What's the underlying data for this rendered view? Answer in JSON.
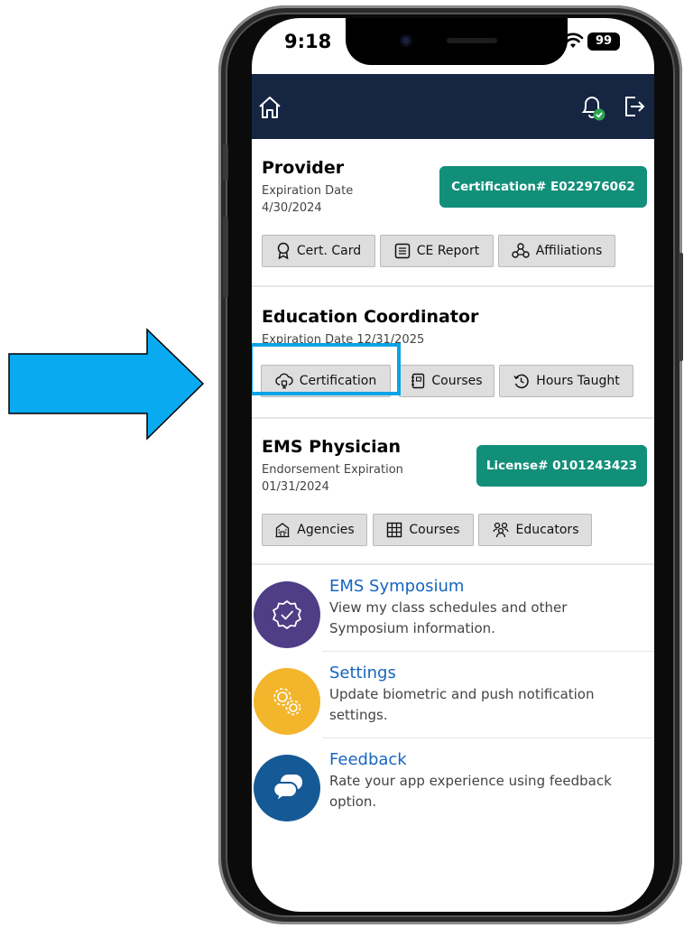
{
  "status_bar": {
    "time": "9:18",
    "battery": "99"
  },
  "provider": {
    "title": "Provider",
    "expiration_label": "Expiration Date",
    "expiration_date": "4/30/2024",
    "certification": "Certification# E022976062",
    "buttons": {
      "cert_card": "Cert. Card",
      "ce_report": "CE Report",
      "affiliations": "Affiliations"
    }
  },
  "education": {
    "title": "Education Coordinator",
    "expiration": "Expiration Date 12/31/2025",
    "buttons": {
      "certification": "Certification",
      "courses": "Courses",
      "hours_taught": "Hours Taught"
    }
  },
  "physician": {
    "title": "EMS Physician",
    "expiration_label": "Endorsement Expiration",
    "expiration_date": "01/31/2024",
    "license": "License# 0101243423",
    "buttons": {
      "agencies": "Agencies",
      "courses": "Courses",
      "educators": "Educators"
    }
  },
  "menu": [
    {
      "title": "EMS Symposium",
      "desc": "View my class schedules and other Symposium information.",
      "icon": "badge-check-icon",
      "color": "#4f3d86"
    },
    {
      "title": "Settings",
      "desc": "Update biometric and push notification settings.",
      "icon": "gears-icon",
      "color": "#f2b52c"
    },
    {
      "title": "Feedback",
      "desc": "Rate your app experience using feedback option.",
      "icon": "chat-bubbles-icon",
      "color": "#155a96"
    }
  ],
  "colors": {
    "navbar": "#152542",
    "accent_green": "#128f79",
    "link_blue": "#1565c0",
    "arrow": "#0aaaf0",
    "highlight": "#0aa3e6"
  }
}
